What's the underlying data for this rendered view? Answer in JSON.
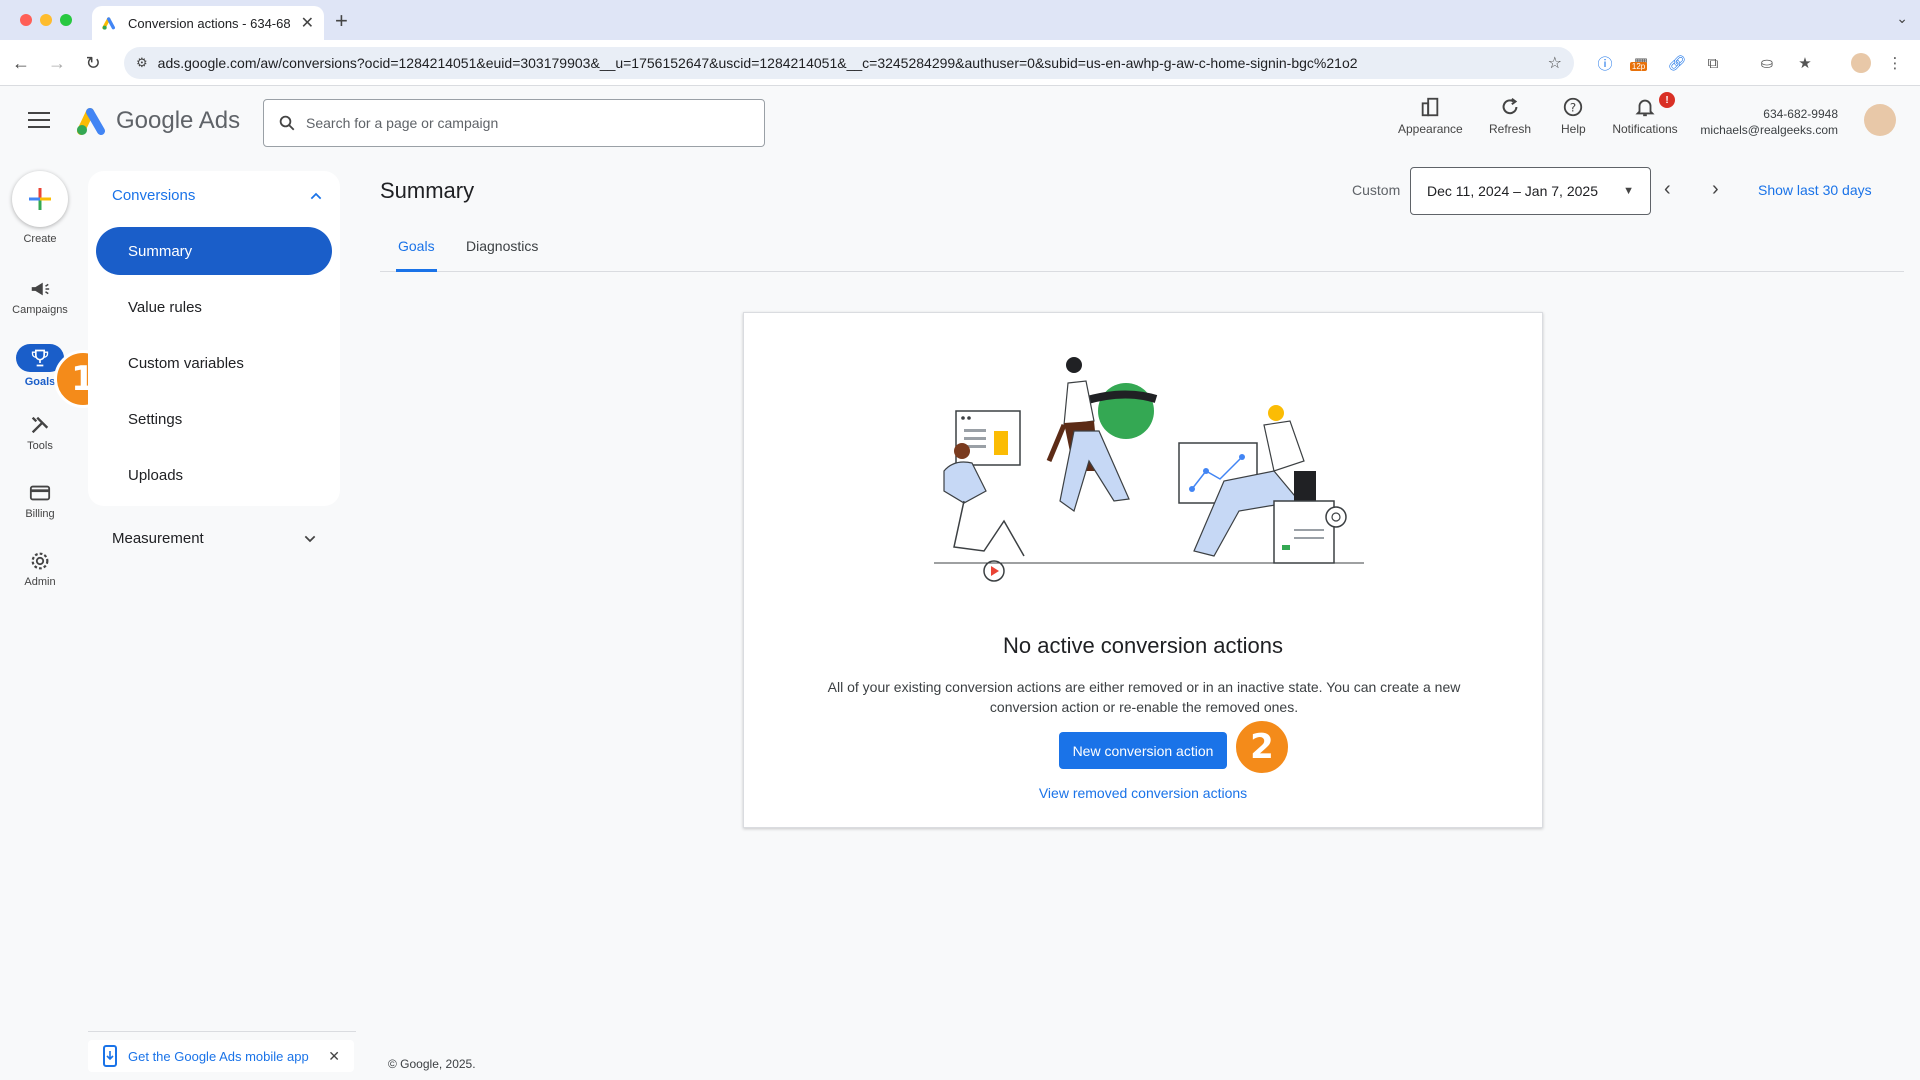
{
  "browser": {
    "tab_title": "Conversion actions - 634-68",
    "url": "ads.google.com/aw/conversions?ocid=1284214051&euid=303179903&__u=1756152647&uscid=1284214051&__c=3245284299&authuser=0&subid=us-en-awhp-g-aw-c-home-signin-bgc%21o2",
    "ext_badge": "12p"
  },
  "header": {
    "brand": "Google Ads",
    "search_placeholder": "Search for a page or campaign",
    "actions": {
      "appearance": "Appearance",
      "refresh": "Refresh",
      "help": "Help",
      "notifications": "Notifications"
    },
    "notif_badge": "!",
    "account_id": "634-682-9948",
    "account_email": "michaels@realgeeks.com"
  },
  "rail": {
    "create": "Create",
    "campaigns": "Campaigns",
    "goals": "Goals",
    "tools": "Tools",
    "billing": "Billing",
    "admin": "Admin"
  },
  "subnav": {
    "section": "Conversions",
    "items": [
      "Summary",
      "Value rules",
      "Custom variables",
      "Settings",
      "Uploads"
    ],
    "measurement": "Measurement"
  },
  "main": {
    "title": "Summary",
    "date_label": "Custom",
    "date_range": "Dec 11, 2024 – Jan 7, 2025",
    "show_last": "Show last 30 days",
    "tabs": [
      "Goals",
      "Diagnostics"
    ]
  },
  "card": {
    "heading": "No active conversion actions",
    "body": "All of your existing conversion actions are either removed or in an inactive state. You can create a new conversion action or re-enable the removed ones.",
    "primary_button": "New conversion action",
    "link": "View removed conversion actions"
  },
  "markers": [
    "1",
    "2"
  ],
  "footer": {
    "mobile_app": "Get the Google Ads mobile app",
    "copyright": "© Google, 2025."
  },
  "colors": {
    "accent": "#1a73e8",
    "nav_active": "#1a5ec9",
    "marker": "#f48b1a"
  }
}
